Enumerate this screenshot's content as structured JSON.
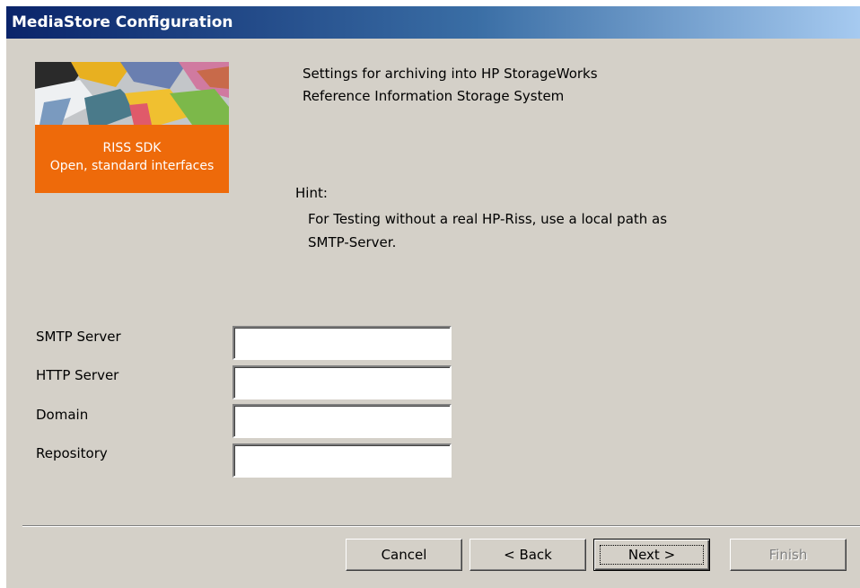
{
  "window": {
    "title": "MediaStore Configuration"
  },
  "banner": {
    "line1": "RISS SDK",
    "line2": "Open, standard interfaces"
  },
  "intro": {
    "line1": "Settings for archiving into  HP StorageWorks",
    "line2": "Reference Information Storage System"
  },
  "hint": {
    "label": "Hint:",
    "line1": "For Testing without a real HP-Riss, use a local path as",
    "line2": "SMTP-Server."
  },
  "form": {
    "smtp_label": "SMTP Server",
    "smtp_value": "",
    "http_label": "HTTP Server",
    "http_value": "",
    "domain_label": "Domain",
    "domain_value": "",
    "repository_label": "Repository",
    "repository_value": ""
  },
  "buttons": {
    "cancel": "Cancel",
    "back": "< Back",
    "next": "Next >",
    "finish": "Finish"
  }
}
